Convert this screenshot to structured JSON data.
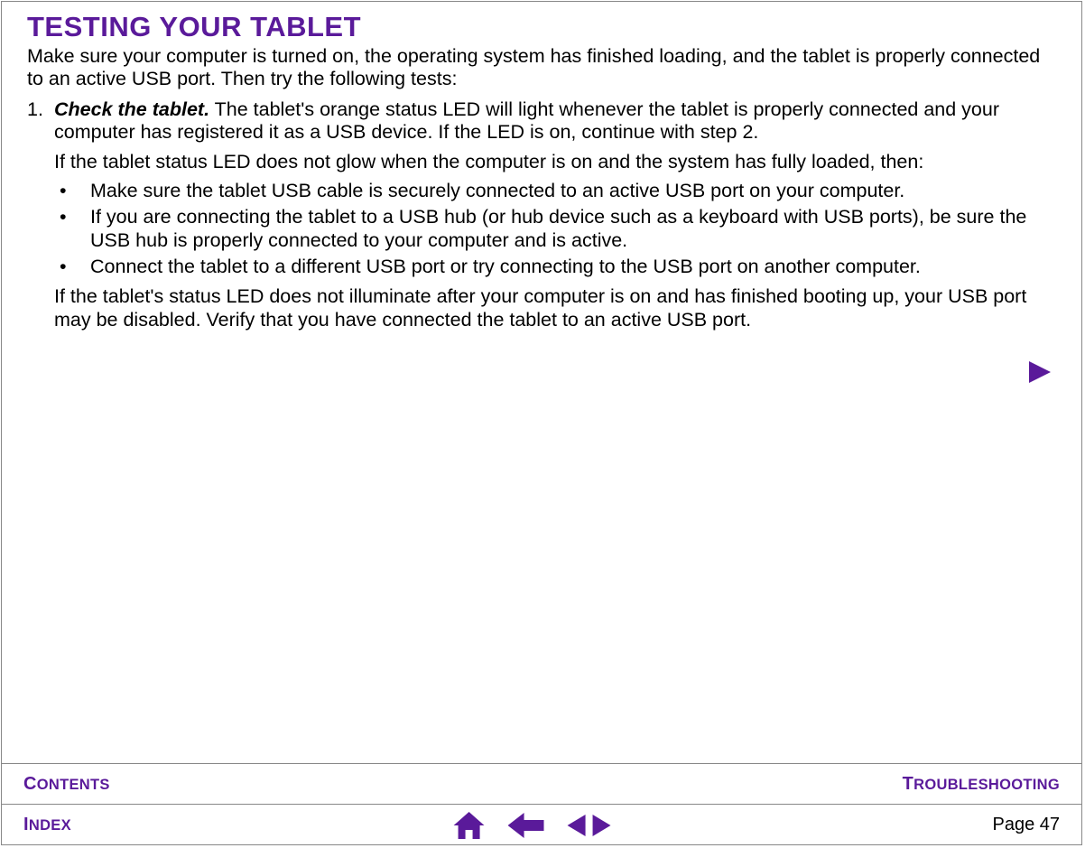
{
  "title": "TESTING YOUR TABLET",
  "intro": "Make sure your computer is turned on, the operating system has finished loading, and the tablet is properly connected to an active USB port.  Then try the following tests:",
  "step1": {
    "num": "1.",
    "lead": "Check the tablet.",
    "lead_rest": "  The tablet's orange status LED will light whenever the tablet is properly connected and your computer has registered it as a USB device.  If the LED is on, continue with step 2.",
    "para2": "If the tablet status LED does not glow when the computer is on and the system has fully loaded, then:",
    "bullets": [
      "Make sure the tablet USB cable is securely connected to an active USB port on your computer.",
      "If you are connecting the tablet to a USB hub (or hub device such as a keyboard with USB ports), be sure the USB hub is properly connected to your computer and is active.",
      "Connect the tablet to a different USB port or try connecting to the USB port on another computer."
    ],
    "para3": "If the tablet's status LED does not illuminate after your computer is on and has finished booting up, your USB port may be disabled.  Verify that you have connected the tablet to an active USB port."
  },
  "footer": {
    "contents": "CONTENTS",
    "troubleshooting": "TROUBLESHOOTING",
    "index": "INDEX",
    "page_label": "Page  47"
  },
  "colors": {
    "accent": "#5a1a9a"
  }
}
